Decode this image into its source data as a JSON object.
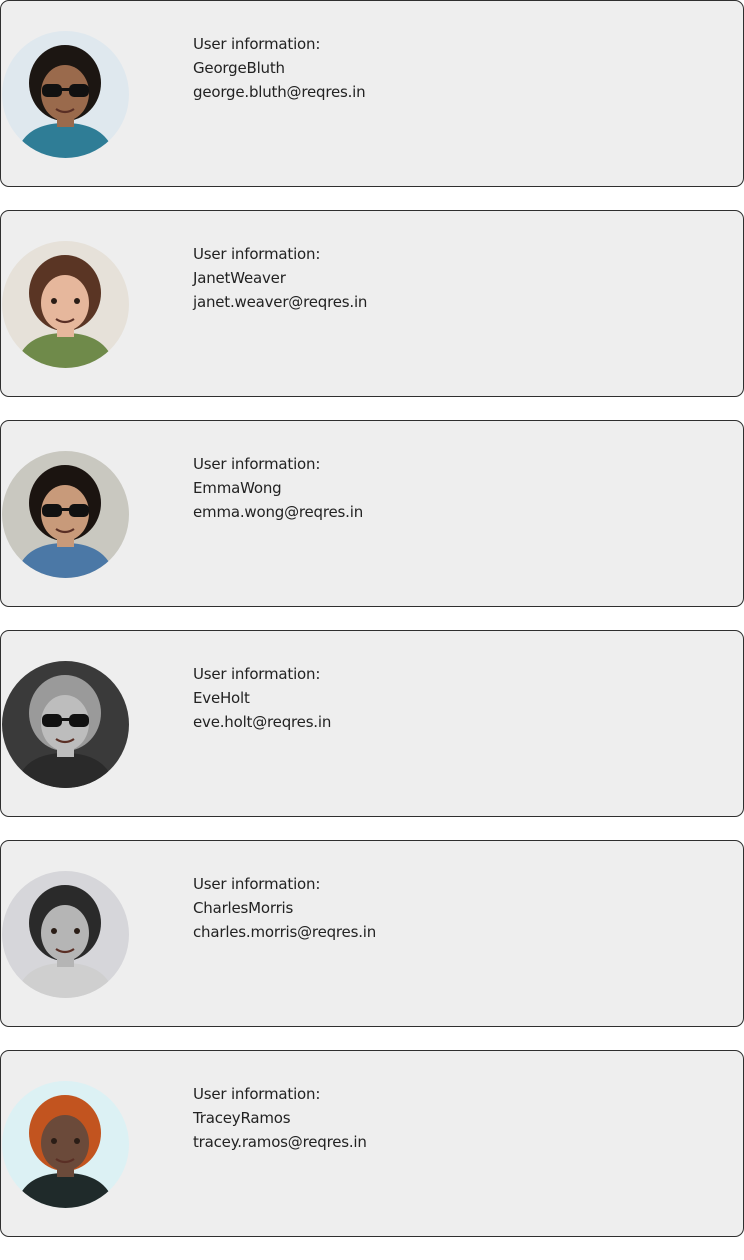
{
  "users": [
    {
      "heading": "User information:",
      "name": "GeorgeBluth",
      "email": "george.bluth@reqres.in",
      "avatar": {
        "bg": "#dfe8ee",
        "skin": "#9a6a4c",
        "hair": "#1c1612",
        "shirt": "#2f7d96",
        "glasses": true
      }
    },
    {
      "heading": "User information:",
      "name": "JanetWeaver",
      "email": "janet.weaver@reqres.in",
      "avatar": {
        "bg": "#e6e1d9",
        "skin": "#e6b79c",
        "hair": "#5a3524",
        "shirt": "#6f8a4a",
        "glasses": false
      }
    },
    {
      "heading": "User information:",
      "name": "EmmaWong",
      "email": "emma.wong@reqres.in",
      "avatar": {
        "bg": "#c9c8c0",
        "skin": "#c89a7a",
        "hair": "#1b1410",
        "shirt": "#4b78a6",
        "glasses": true
      }
    },
    {
      "heading": "User information:",
      "name": "EveHolt",
      "email": "eve.holt@reqres.in",
      "avatar": {
        "bg": "#3a3a3a",
        "skin": "#bdbdbd",
        "hair": "#9a9a9a",
        "shirt": "#2a2a2a",
        "glasses": true
      }
    },
    {
      "heading": "User information:",
      "name": "CharlesMorris",
      "email": "charles.morris@reqres.in",
      "avatar": {
        "bg": "#d6d6da",
        "skin": "#b5b5b5",
        "hair": "#2a2a2a",
        "shirt": "#cfcfcf",
        "glasses": false
      }
    },
    {
      "heading": "User information:",
      "name": "TraceyRamos",
      "email": "tracey.ramos@reqres.in",
      "avatar": {
        "bg": "#dcf1f4",
        "skin": "#6b4a3a",
        "hair": "#c2541f",
        "shirt": "#1f2a2a",
        "glasses": false
      }
    }
  ]
}
